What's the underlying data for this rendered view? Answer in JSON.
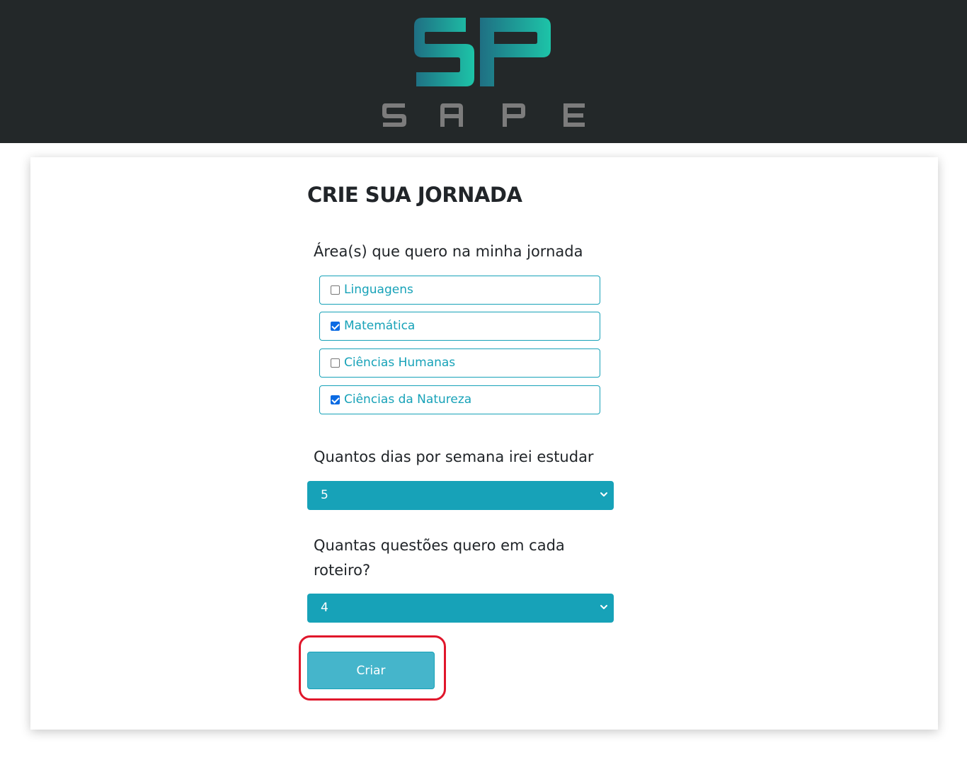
{
  "brand": {
    "logo_text": "SAPE",
    "colors": {
      "header_bg": "#232829",
      "logo_gradient_start": "#1f6f83",
      "logo_gradient_end": "#1dc4a8",
      "logo_text": "#7c7c7c"
    }
  },
  "form": {
    "title": "CRIE SUA JORNADA",
    "areas_label": "Área(s) que quero na minha jornada",
    "areas": [
      {
        "label": "Linguagens",
        "checked": false
      },
      {
        "label": "Matemática",
        "checked": true
      },
      {
        "label": "Ciências Humanas",
        "checked": false
      },
      {
        "label": "Ciências da Natureza",
        "checked": true
      }
    ],
    "days_label": "Quantos dias por semana irei estudar",
    "days_value": "5",
    "questions_label": "Quantas questões quero em cada roteiro?",
    "questions_value": "4",
    "submit_label": "Criar"
  },
  "colors": {
    "accent": "#17a2b8",
    "button": "#45b5cb",
    "highlight": "#e0162b"
  }
}
